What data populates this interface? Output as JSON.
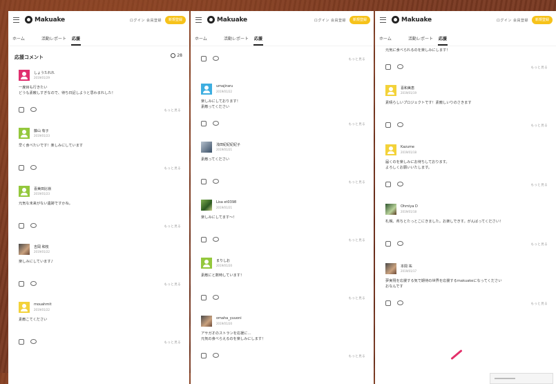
{
  "header": {
    "logo": "Makuake",
    "links": "ログイン 会員登録",
    "button": "新規登録"
  },
  "tabs": [
    "ホーム",
    "活動レポート",
    "応援"
  ],
  "section": {
    "title": "応援コメント",
    "count": "28"
  },
  "more_label": "もっと見る",
  "panel1": [
    {
      "name": "しょうたれれ",
      "date": "2019/01/29",
      "body": "一度目も行きたい\nどうも素敵しすぎなので、待ち日記しようと思わまれした！",
      "avatar": "pink"
    },
    {
      "name": "藤山 有子",
      "date": "2019/01/23",
      "body": "早く食べたいです！楽しみにしています",
      "avatar": "green"
    },
    {
      "name": "喜美田比嶺",
      "date": "2019/01/23",
      "body": "元気な未来がない遺跡ですかね。",
      "avatar": "green"
    },
    {
      "name": "吉岡 和枝",
      "date": "2019/01/22",
      "body": "楽しみにしています♪",
      "avatar": "photo"
    },
    {
      "name": "mouahmit",
      "date": "2019/01/22",
      "body": "素敵こてください",
      "avatar": "yellow"
    }
  ],
  "panel2_top": "",
  "panel2": [
    {
      "name": "umajiraru",
      "date": "2019/01/22",
      "body": "楽しみにしております！\n素敵ってください",
      "avatar": "blue"
    },
    {
      "name": "浅田紀紀紀紀子",
      "date": "2019/01/21",
      "body": "素敵ってください",
      "avatar": "photo2"
    },
    {
      "name": "Lisa et0398",
      "date": "2019/01/21",
      "body": "楽しみにしてます～！",
      "avatar": "photo3"
    },
    {
      "name": "まりしお",
      "date": "2019/01/20",
      "body": "素敵にと数時しています！",
      "avatar": "green"
    },
    {
      "name": "omaha_yuuoni",
      "date": "2019/01/20",
      "body": "アサガオのストランを応援に…\n元気の食べらえるのを楽しみにします！",
      "avatar": "photo"
    }
  ],
  "panel3_top": "元気に食べられるのを楽しみにします！",
  "panel3": [
    {
      "name": "喜和美恵",
      "date": "2019/01/19",
      "body": "素晴らしいプロジェクトです！素敵しいりのさきます",
      "avatar": "yellow"
    },
    {
      "name": "Kazume",
      "date": "2019/01/18",
      "body": "届くのを楽しみにお待ちしております。\nよろしくお願いいたします。",
      "avatar": "yellow"
    },
    {
      "name": "Ohmiya D",
      "date": "2019/01/18",
      "body": "札幌、県ちとたっとこにきました。お楽しできす。がんばってください！",
      "avatar": "photo4"
    },
    {
      "name": "本間 祐",
      "date": "2019/01/17",
      "body": "夢実現を応援する気で期待の世界を応援するmakuakeになってください\nおなんです",
      "avatar": "photo"
    }
  ],
  "colors": {
    "accent": "#f6c21a",
    "brand": "#222222"
  }
}
